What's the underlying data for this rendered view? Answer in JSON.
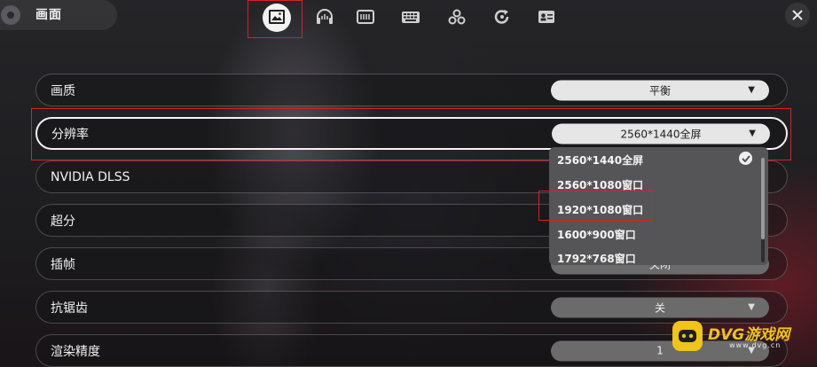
{
  "header": {
    "title": "画面",
    "tabs": [
      {
        "name": "display",
        "icon": "image-icon",
        "active": true
      },
      {
        "name": "audio",
        "icon": "headphones-icon",
        "active": false
      },
      {
        "name": "controls",
        "icon": "controller-icon",
        "active": false
      },
      {
        "name": "keyboard",
        "icon": "keyboard-icon",
        "active": false
      },
      {
        "name": "interface",
        "icon": "circles-icon",
        "active": false
      },
      {
        "name": "language",
        "icon": "refresh-icon",
        "active": false
      },
      {
        "name": "account",
        "icon": "id-card-icon",
        "active": false
      }
    ]
  },
  "settings": [
    {
      "label": "画质",
      "value": "平衡",
      "arrow": "▼",
      "enabled": true
    },
    {
      "label": "分辨率",
      "value": "2560*1440全屏",
      "arrow": "▼",
      "enabled": true,
      "focused": true
    },
    {
      "label": "NVIDIA DLSS",
      "value": "",
      "arrow": "",
      "enabled": true
    },
    {
      "label": "超分",
      "value": "",
      "arrow": "",
      "enabled": true
    },
    {
      "label": "插帧",
      "value": "关闭",
      "arrow": "",
      "enabled": true
    },
    {
      "label": "抗锯齿",
      "value": "关",
      "arrow": "▼",
      "enabled": false
    },
    {
      "label": "渲染精度",
      "value": "1",
      "arrow": "▼",
      "enabled": false
    }
  ],
  "resolution_dropdown": {
    "options": [
      "2560*1440全屏",
      "2560*1080窗口",
      "1920*1080窗口",
      "1600*900窗口",
      "1792*768窗口"
    ],
    "selected": "2560*1440全屏",
    "highlighted": "1920*1080窗口"
  },
  "watermark": {
    "brand": "DVG游戏网",
    "url": "www.dvg.cn"
  },
  "colors": {
    "highlight_box": "#d8202a",
    "select_bg": "#e6e6e6",
    "select_disabled_bg": "#6b6b6b",
    "dropdown_bg": "#555557",
    "watermark_yellow": "#f0c419"
  }
}
